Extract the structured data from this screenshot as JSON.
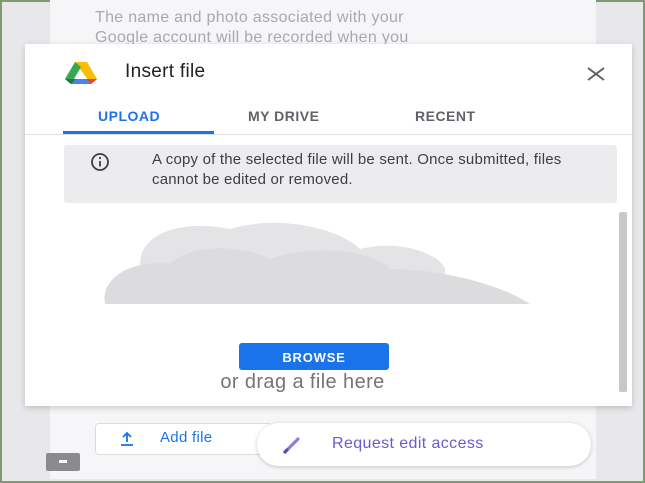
{
  "background": {
    "notice_lines": [
      "The name and photo associated with your",
      "Google account will be recorded when you"
    ]
  },
  "dialog": {
    "title": "Insert file",
    "logo_icon": "google-drive-icon",
    "close_icon": "close-icon",
    "tabs": [
      {
        "label": "UPLOAD",
        "active": true
      },
      {
        "label": "MY DRIVE",
        "active": false
      },
      {
        "label": "RECENT",
        "active": false
      }
    ],
    "info": {
      "icon": "info-icon",
      "text": "A copy of the selected file will be sent. Once submitted, files cannot be edited or removed."
    },
    "illustration": "cloud-illustration",
    "browse_label": "BROWSE",
    "drag_text": "or drag a file here"
  },
  "form": {
    "add_file_label": "Add file",
    "add_file_icon": "upload-icon",
    "request_edit_label": "Request edit access",
    "request_edit_icon": "pencil-icon",
    "feedback_icon": "feedback-icon"
  },
  "colors": {
    "accent": "#1a73e8",
    "request_text": "#6d5ad0",
    "frame_border": "#7f9a6e"
  }
}
